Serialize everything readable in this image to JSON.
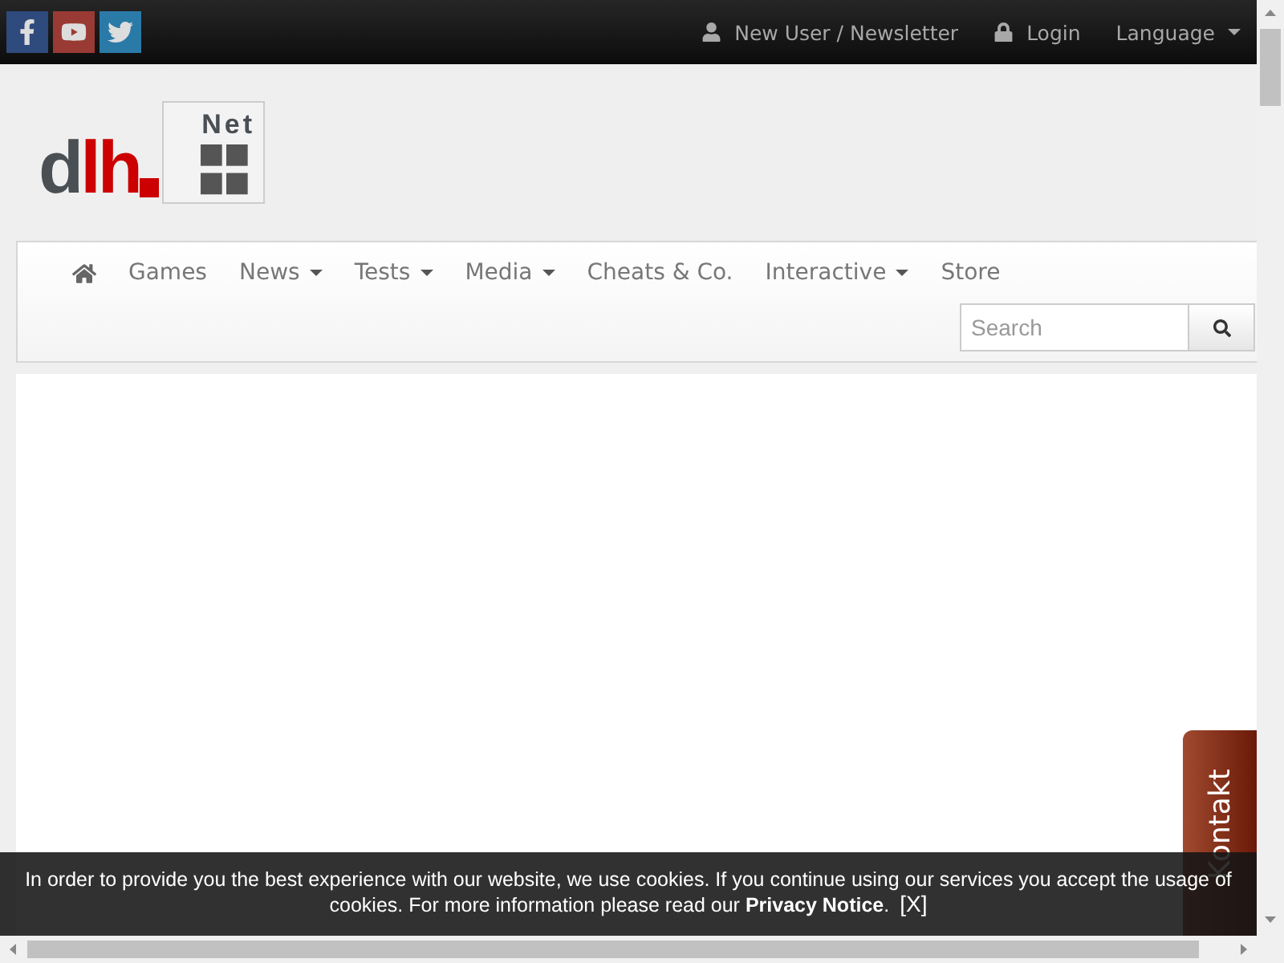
{
  "top_bar": {
    "social": [
      {
        "kind": "facebook",
        "color": "#2f4a7c"
      },
      {
        "kind": "youtube",
        "color": "#9a3a34"
      },
      {
        "kind": "twitter",
        "color": "#2a7aa8"
      }
    ],
    "links": [
      {
        "kind": "user",
        "label": "New User / Newsletter",
        "dropdown": false
      },
      {
        "kind": "lock",
        "label": "Login",
        "dropdown": false
      },
      {
        "kind": "none",
        "label": "Language",
        "dropdown": true
      }
    ]
  },
  "logo": {
    "parts": [
      {
        "text": "d",
        "color": "#4a4f54"
      },
      {
        "text": "lh",
        "color": "#cc0000"
      }
    ],
    "suffix": "Net"
  },
  "nav": {
    "items": [
      {
        "kind": "home"
      },
      {
        "kind": "text",
        "label": "Games",
        "dropdown": false
      },
      {
        "kind": "text",
        "label": "News",
        "dropdown": true
      },
      {
        "kind": "text",
        "label": "Tests",
        "dropdown": true
      },
      {
        "kind": "text",
        "label": "Media",
        "dropdown": true
      },
      {
        "kind": "text",
        "label": "Cheats & Co.",
        "dropdown": false
      },
      {
        "kind": "text",
        "label": "Interactive",
        "dropdown": true
      },
      {
        "kind": "text",
        "label": "Store",
        "dropdown": false
      }
    ],
    "search": {
      "placeholder": "Search"
    }
  },
  "contact_tab": {
    "label": "Kontakt"
  },
  "cookie_notice": {
    "text": "In order to provide you the best experience with our website, we use cookies. If you continue using our services you accept the usage of cookies. For more information please read our",
    "link": "Privacy Notice",
    "after": ".",
    "close": "[X]"
  }
}
